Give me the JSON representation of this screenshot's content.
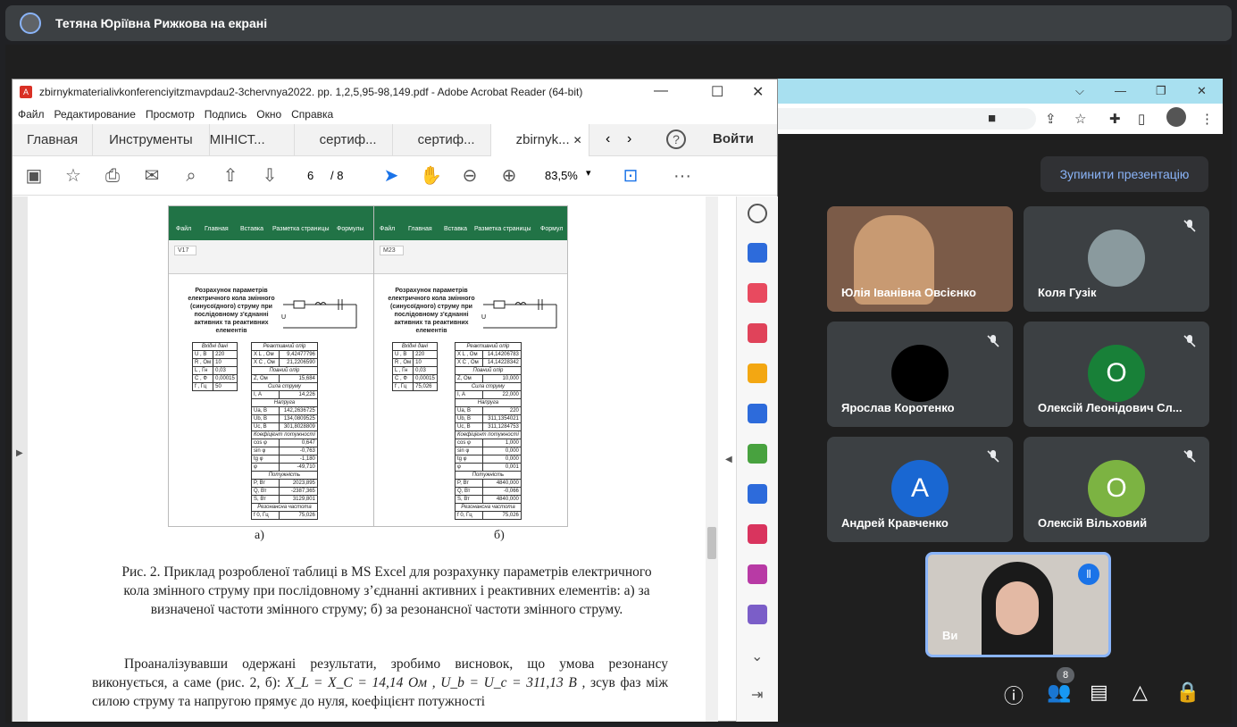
{
  "presenter_bar": {
    "title": "Тетяна Юріївна Рижкова на екрані"
  },
  "chrome": {
    "icons": [
      "chevron-down-icon",
      "minimize-icon",
      "restore-icon",
      "close-icon",
      "camera-icon",
      "share-icon",
      "star-icon",
      "extensions-icon",
      "sidebar-icon",
      "profile-icon",
      "more-icon"
    ]
  },
  "acrobat": {
    "title": "zbirnykmaterialivkonferenciyitzmavpdau2-3chervnya2022. pp. 1,2,5,95-98,149.pdf - Adobe Acrobat Reader (64-bit)",
    "menu": [
      "Файл",
      "Редактирование",
      "Просмотр",
      "Подпись",
      "Окно",
      "Справка"
    ],
    "tabs": [
      "Главная",
      "Инструменты",
      "МІНІСТ...",
      "сертиф...",
      "сертиф...",
      "zbirnyk..."
    ],
    "signin": "Войти",
    "page_current": "6",
    "page_total": "/ 8",
    "zoom": "83,5%"
  },
  "excel_a": {
    "ribbon": [
      "Файл",
      "Главная",
      "Вставка",
      "Разметка страницы",
      "Формулы"
    ],
    "cell": "V17",
    "heading": "Розрахунок параметрів електричного кола змінного (синусоїдного) струму при послідовному з'єднанні активних та реактивних елементів",
    "inputs_title": "Вхідні дані",
    "inputs": [
      [
        "U , В",
        "220"
      ],
      [
        "R , Ом",
        "10"
      ],
      [
        "L , Гн",
        "0,03"
      ],
      [
        "C , Ф",
        "0,00015"
      ],
      [
        "f , Гц",
        "50"
      ]
    ],
    "results": [
      [
        "Реактивний опір",
        ""
      ],
      [
        "X L , Ом",
        "9,42477796"
      ],
      [
        "X C , Ом",
        "21,2206590"
      ],
      [
        "Повний опір",
        ""
      ],
      [
        "Z, Ом",
        "15,684"
      ],
      [
        "Сила струму",
        ""
      ],
      [
        "I, А",
        "14,226"
      ],
      [
        "Напруга",
        ""
      ],
      [
        "Ua, В",
        "142,2636725"
      ],
      [
        "Ub, В",
        "134,0809525"
      ],
      [
        "Uc, В",
        "301,8028809"
      ],
      [
        "Коефіцієнт потужності",
        ""
      ],
      [
        "cos φ",
        "0,647"
      ],
      [
        "sin φ",
        "-0,763"
      ],
      [
        "tg φ",
        "-1,180"
      ],
      [
        "φ",
        "-49,710"
      ],
      [
        "Потужність",
        ""
      ],
      [
        "P, Вт",
        "2023,895"
      ],
      [
        "Q, Вт",
        "-2387,365"
      ],
      [
        "S, Вт",
        "3129,801"
      ],
      [
        "Резонансна частота",
        ""
      ],
      [
        "f 0, Гц",
        "75,026"
      ]
    ]
  },
  "excel_b": {
    "ribbon": [
      "Файл",
      "Главная",
      "Вставка",
      "Разметка страницы",
      "Формул"
    ],
    "cell": "M23",
    "heading": "Розрахунок параметрів електричного кола змінного (синусоїдного) струму при послідовному з'єднанні активних та реактивних елементів",
    "inputs_title": "Вхідні дані",
    "inputs": [
      [
        "U , В",
        "220"
      ],
      [
        "R , Ом",
        "10"
      ],
      [
        "L , Гн",
        "0,03"
      ],
      [
        "C , Ф",
        "0,00015"
      ],
      [
        "f , Гц",
        "75,026"
      ]
    ],
    "results": [
      [
        "Реактивний опір",
        ""
      ],
      [
        "X L , Ом",
        "14,14206783"
      ],
      [
        "X C , Ом",
        "14,14228342"
      ],
      [
        "Повний опір",
        ""
      ],
      [
        "Z, Ом",
        "10,000"
      ],
      [
        "Сила струму",
        ""
      ],
      [
        "I, А",
        "22,000"
      ],
      [
        "Напруга",
        ""
      ],
      [
        "Ua, В",
        "220"
      ],
      [
        "Ub, В",
        "311,1354021"
      ],
      [
        "Uc, В",
        "311,1284753"
      ],
      [
        "Коефіцієнт потужності",
        ""
      ],
      [
        "cos φ",
        "1,000"
      ],
      [
        "sin φ",
        "0,000"
      ],
      [
        "tg φ",
        "0,000"
      ],
      [
        "φ",
        "0,001"
      ],
      [
        "Потужність",
        ""
      ],
      [
        "P, Вт",
        "4840,000"
      ],
      [
        "Q, Вт",
        "-0,066"
      ],
      [
        "S, Вт",
        "4840,000"
      ],
      [
        "Резонансна частота",
        ""
      ],
      [
        "f 0, Гц",
        "75,026"
      ]
    ]
  },
  "doc": {
    "label_a": "а)",
    "label_b": "б)",
    "caption": "Рис. 2. Приклад розробленої таблиці в MS Excel для розрахунку параметрів електричного кола змінного струму при послідовному з’єднанні активних і реактивних елементів: а) за визначеної частоти змінного струму; б) за резонансної частоти змінного струму.",
    "para1": "Проаналізувавши одержані результати, зробимо висновок, що умова резонансу виконується, а саме (рис. 2, б):",
    "formula": "X_L = X_C = 14,14 Ом , U_b = U_c = 311,13 В ,",
    "para2": "зсув фаз між силою струму та напругою прямує до нуля, коефіцієнт потужності"
  },
  "meet": {
    "stop_presentation": "Зупинити презентацію",
    "participants": [
      {
        "name": "Юлія Іванівна Овсієнко",
        "kind": "video",
        "muted": false
      },
      {
        "name": "Коля Гузік",
        "kind": "photo",
        "muted": true
      },
      {
        "name": "Ярослав Коротенко",
        "kind": "avatar",
        "letter": "",
        "color": "#000000",
        "muted": true
      },
      {
        "name": "Олексій Леонідович Сл...",
        "kind": "avatar",
        "letter": "О",
        "color": "#188038",
        "muted": true
      },
      {
        "name": "Андрей Кравченко",
        "kind": "avatar",
        "letter": "А",
        "color": "#1967d2",
        "muted": true
      },
      {
        "name": "Олексій Вільховий",
        "kind": "avatar",
        "letter": "О",
        "color": "#7cb342",
        "muted": true
      },
      {
        "name": "Ви",
        "kind": "video",
        "muted": false,
        "speaking": true
      }
    ],
    "people_count": "8",
    "bottom_icons": [
      "info-icon",
      "people-icon",
      "chat-icon",
      "activities-icon",
      "host-controls-icon"
    ]
  }
}
